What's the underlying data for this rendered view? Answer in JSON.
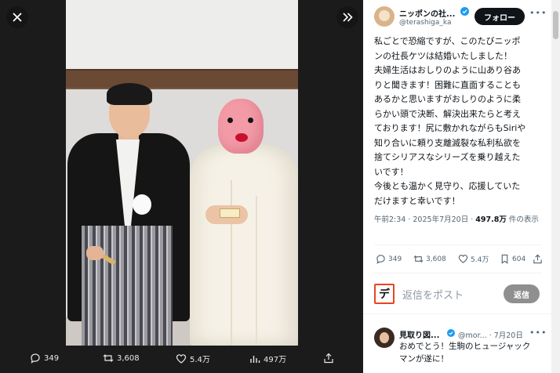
{
  "viewer": {
    "close_icon": "close-icon",
    "expand_icon": "chevrons-right-icon",
    "actions": [
      {
        "icon": "reply-icon",
        "count": "349"
      },
      {
        "icon": "retweet-icon",
        "count": "3,608"
      },
      {
        "icon": "like-icon",
        "count": "5.4万"
      },
      {
        "icon": "views-icon",
        "count": "497万"
      },
      {
        "icon": "share-icon",
        "count": ""
      }
    ]
  },
  "tweet": {
    "author_name": "ニッポンの社...",
    "handle": "@terashiga_ka",
    "follow_label": "フォロー",
    "lines": [
      "私ごとで恐縮ですが、このたびニッポ",
      "ンの社長ケツは結婚いたしました！",
      "夫婦生活はおしりのように山あり谷あ",
      "りと聞きます！困難に直面することも",
      "あるかと思いますがおしりのように柔",
      "らかい頭で決断、解決出来たらと考え",
      "ております！尻に敷かれながらもSiriや",
      "知り合いに頼り支離滅裂な私利私欲を",
      "捨てシリアスなシリーズを乗り越えた",
      "いです！",
      "今後とも温かく見守り、応援していた",
      "だけますと幸いです！"
    ],
    "timestamp": "午前2:34 · 2025年7月20日 · ",
    "views": "497.8万",
    "views_suffix": " 件の表示",
    "actions": {
      "reply": "349",
      "retweet": "3,608",
      "like": "5.4万",
      "bookmark": "604"
    }
  },
  "compose": {
    "avatar_glyph": "デ",
    "placeholder": "返信をポスト",
    "reply_button": "返信"
  },
  "reply": {
    "name": "見取り図...",
    "handle": "@mor... · 7月20日",
    "lines": [
      "おめでとう！生駒のヒュージャック",
      "マンが遂に！"
    ]
  },
  "colors": {
    "verified": "#1d9bf0",
    "follow_bg": "#0f1419",
    "accent_orange": "#e8451e"
  }
}
